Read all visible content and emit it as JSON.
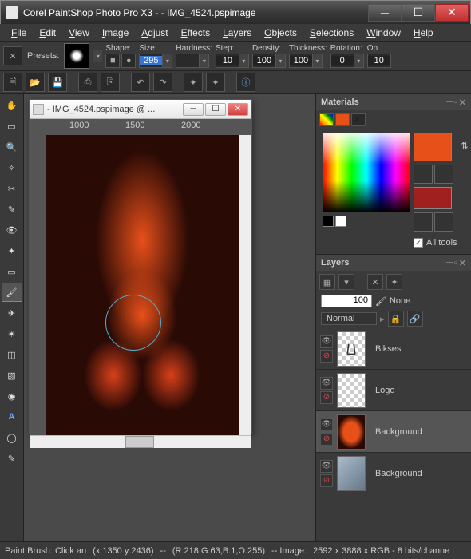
{
  "title": "Corel PaintShop Photo Pro X3 -  - IMG_4524.pspimage",
  "menu": [
    "File",
    "Edit",
    "View",
    "Image",
    "Adjust",
    "Effects",
    "Layers",
    "Objects",
    "Selections",
    "Window",
    "Help"
  ],
  "options": {
    "presets_label": "Presets:",
    "shape_label": "Shape:",
    "size_label": "Size:",
    "size_val": "295",
    "hardness_label": "Hardness:",
    "hardness_val": "",
    "step_label": "Step:",
    "step_val": "10",
    "density_label": "Density:",
    "density_val": "100",
    "thickness_label": "Thickness:",
    "thickness_val": "100",
    "rotation_label": "Rotation:",
    "rotation_val": "0",
    "op_label": "Op",
    "op_val": "10"
  },
  "doc": {
    "title": " - IMG_4524.pspimage @ ...",
    "ruler_h": [
      "1000",
      "1500",
      "2000"
    ],
    "ruler_v": [
      "",
      "",
      "",
      "",
      ""
    ]
  },
  "materials": {
    "title": "Materials",
    "all_tools": "All tools"
  },
  "layers": {
    "title": "Layers",
    "opacity": "100",
    "mode_label": "None",
    "blend": "Normal",
    "items": [
      {
        "name": "Bikses"
      },
      {
        "name": "Logo"
      },
      {
        "name": "Background"
      },
      {
        "name": "Background"
      }
    ]
  },
  "status": {
    "tool": "Paint Brush: Click an",
    "pos": "(x:1350 y:2436)",
    "sep1": "--",
    "color": "(R:218,G:63,B:1,O:255)",
    "sep2": "-- Image:",
    "img": "2592 x 3888 x RGB - 8 bits/channe"
  }
}
